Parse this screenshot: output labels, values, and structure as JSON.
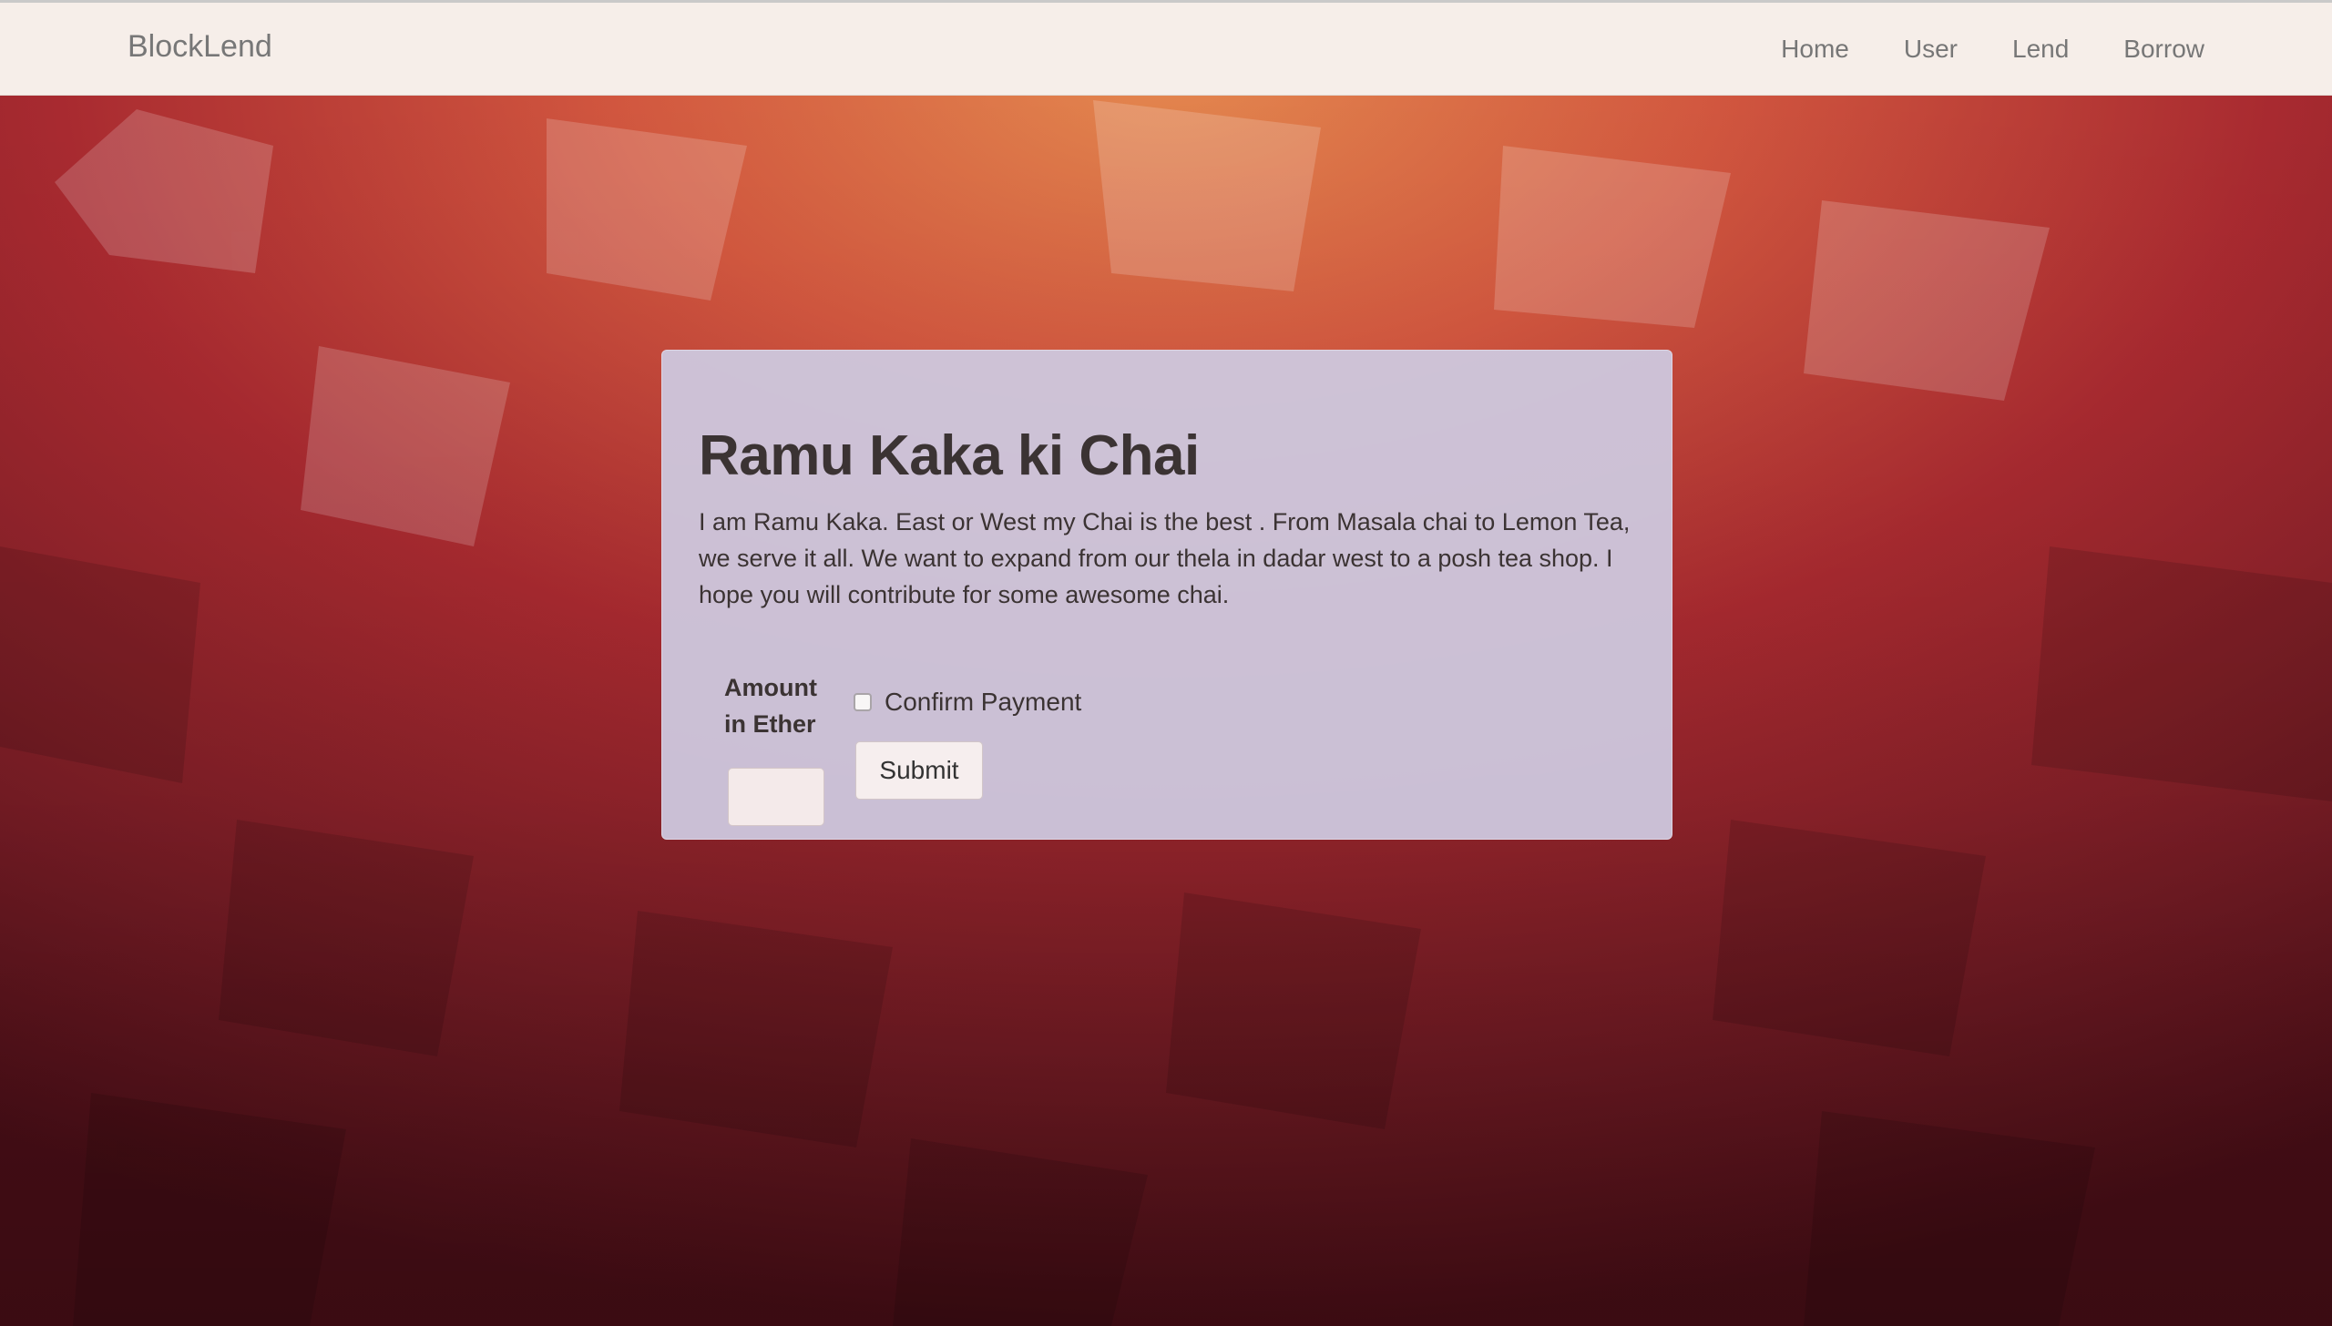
{
  "navbar": {
    "brand": "BlockLend",
    "links": [
      {
        "label": "Home"
      },
      {
        "label": "User"
      },
      {
        "label": "Lend"
      },
      {
        "label": "Borrow"
      }
    ]
  },
  "campaign": {
    "title": "Ramu Kaka ki Chai",
    "description": "I am Ramu Kaka. East or West my Chai is the best . From Masala chai to Lemon Tea, we serve it all. We want to expand from our thela in dadar west to a posh tea shop. I hope you will contribute for some awesome chai."
  },
  "form": {
    "amount_label": "Amount in Ether",
    "amount_value": "",
    "confirm_label": "Confirm Payment",
    "confirm_checked": false,
    "submit_label": "Submit"
  },
  "colors": {
    "navbar_bg": "#f6eee9",
    "card_bg": "#cdc8de",
    "text": "#3b3333",
    "nav_text": "#777777",
    "background_top": "#e07a4f",
    "background_bottom": "#4e0f18"
  }
}
